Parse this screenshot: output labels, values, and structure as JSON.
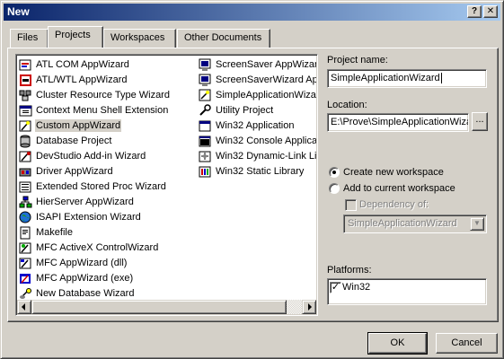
{
  "window": {
    "title": "New",
    "help_glyph": "?",
    "close_glyph": "✕"
  },
  "tabs": [
    {
      "label": "Files"
    },
    {
      "label": "Projects"
    },
    {
      "label": "Workspaces"
    },
    {
      "label": "Other Documents"
    }
  ],
  "project_types_col1": [
    {
      "label": "ATL COM AppWizard",
      "icon": "atl-icon"
    },
    {
      "label": "ATL/WTL AppWizard",
      "icon": "atl-wtl-icon"
    },
    {
      "label": "Cluster Resource Type Wizard",
      "icon": "cluster-icon"
    },
    {
      "label": "Context Menu Shell Extension",
      "icon": "shell-ext-icon"
    },
    {
      "label": "Custom AppWizard",
      "icon": "custom-wizard-icon"
    },
    {
      "label": "Database Project",
      "icon": "database-icon"
    },
    {
      "label": "DevStudio Add-in Wizard",
      "icon": "addin-icon"
    },
    {
      "label": "Driver AppWizard",
      "icon": "driver-icon"
    },
    {
      "label": "Extended Stored Proc Wizard",
      "icon": "stored-proc-icon"
    },
    {
      "label": "HierServer AppWizard",
      "icon": "hierserver-icon"
    },
    {
      "label": "ISAPI Extension Wizard",
      "icon": "globe-icon"
    },
    {
      "label": "Makefile",
      "icon": "makefile-icon"
    },
    {
      "label": "MFC ActiveX ControlWizard",
      "icon": "activex-icon"
    },
    {
      "label": "MFC AppWizard (dll)",
      "icon": "mfc-dll-icon"
    },
    {
      "label": "MFC AppWizard (exe)",
      "icon": "mfc-exe-icon"
    },
    {
      "label": "New Database Wizard",
      "icon": "new-db-icon"
    }
  ],
  "project_types_col2": [
    {
      "label": "ScreenSaver AppWizard",
      "icon": "screensaver-icon"
    },
    {
      "label": "ScreenSaverWizard App",
      "icon": "screensaver-icon"
    },
    {
      "label": "SimpleApplicationWizard",
      "icon": "wizard-icon"
    },
    {
      "label": "Utility Project",
      "icon": "utility-icon"
    },
    {
      "label": "Win32 Application",
      "icon": "win32-app-icon"
    },
    {
      "label": "Win32 Console Applicat",
      "icon": "console-icon"
    },
    {
      "label": "Win32 Dynamic-Link Lib",
      "icon": "dll-icon"
    },
    {
      "label": "Win32 Static Library",
      "icon": "static-lib-icon"
    }
  ],
  "selected_item": "Custom AppWizard",
  "form": {
    "project_name_label": "Project name:",
    "project_name_value": "SimpleApplicationWizard",
    "location_label": "Location:",
    "location_value": "E:\\Prove\\SimpleApplicationWiza",
    "browse_label": "...",
    "create_new_label": "Create new workspace",
    "add_current_label": "Add to current workspace",
    "dependency_label": "Dependency of:",
    "dependency_value": "SimpleApplicationWizard",
    "platforms_label": "Platforms:",
    "platforms": [
      {
        "label": "Win32",
        "checked": true
      }
    ]
  },
  "buttons": {
    "ok": "OK",
    "cancel": "Cancel"
  },
  "colors": {
    "title_start": "#0a246a",
    "title_end": "#a6caf0",
    "face": "#d4d0c8"
  }
}
